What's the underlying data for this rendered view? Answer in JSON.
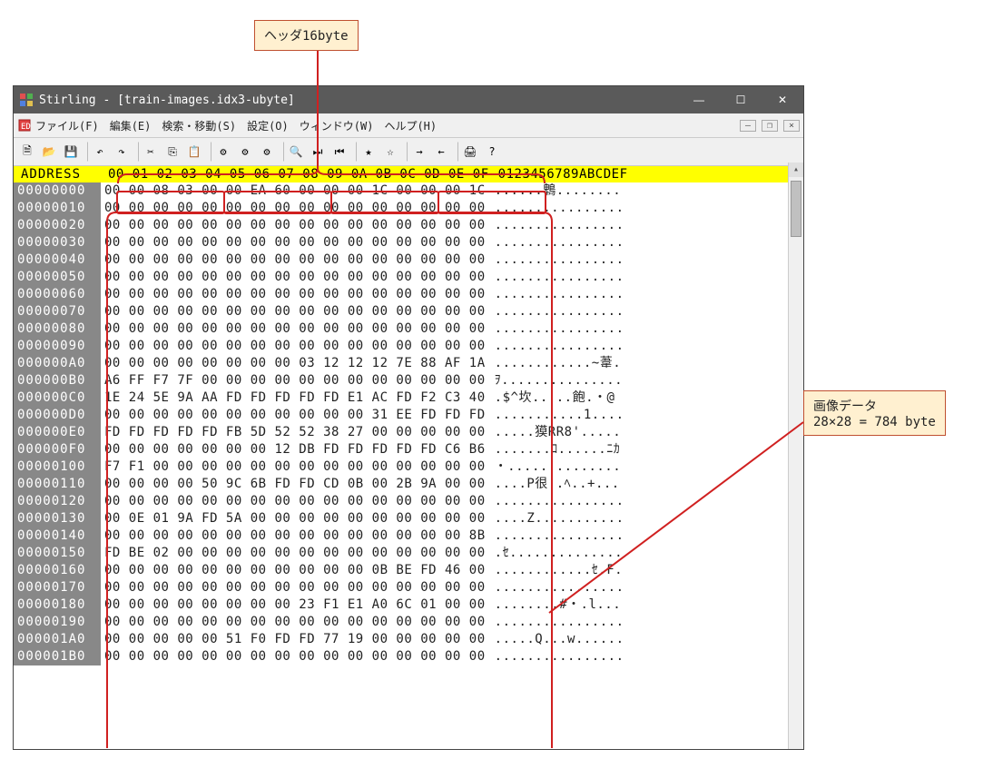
{
  "callouts": {
    "header_label": "ヘッダ16byte",
    "image_label_line1": "画像データ",
    "image_label_line2": "28×28 = 784 byte"
  },
  "app": {
    "title": "Stirling - [train-images.idx3-ubyte]"
  },
  "menu": {
    "file": "ファイル(F)",
    "edit": "編集(E)",
    "search": "検索・移動(S)",
    "settings": "設定(O)",
    "window": "ウィンドウ(W)",
    "help": "ヘルプ(H)"
  },
  "hex_header": {
    "address": "ADDRESS",
    "bytes": "00 01 02 03 04 05 06 07 08 09 0A 0B 0C 0D 0E 0F",
    "ascii": "0123456789ABCDEF"
  },
  "rows": [
    {
      "addr": "00000000",
      "hex": "00 00 08 03 00 00 EA 60 00 00 00 1C 00 00 00 1C",
      "asc": "......鵯........"
    },
    {
      "addr": "00000010",
      "hex": "00 00 00 00 00 00 00 00 00 00 00 00 00 00 00 00",
      "asc": "................"
    },
    {
      "addr": "00000020",
      "hex": "00 00 00 00 00 00 00 00 00 00 00 00 00 00 00 00",
      "asc": "................"
    },
    {
      "addr": "00000030",
      "hex": "00 00 00 00 00 00 00 00 00 00 00 00 00 00 00 00",
      "asc": "................"
    },
    {
      "addr": "00000040",
      "hex": "00 00 00 00 00 00 00 00 00 00 00 00 00 00 00 00",
      "asc": "................"
    },
    {
      "addr": "00000050",
      "hex": "00 00 00 00 00 00 00 00 00 00 00 00 00 00 00 00",
      "asc": "................"
    },
    {
      "addr": "00000060",
      "hex": "00 00 00 00 00 00 00 00 00 00 00 00 00 00 00 00",
      "asc": "................"
    },
    {
      "addr": "00000070",
      "hex": "00 00 00 00 00 00 00 00 00 00 00 00 00 00 00 00",
      "asc": "................"
    },
    {
      "addr": "00000080",
      "hex": "00 00 00 00 00 00 00 00 00 00 00 00 00 00 00 00",
      "asc": "................"
    },
    {
      "addr": "00000090",
      "hex": "00 00 00 00 00 00 00 00 00 00 00 00 00 00 00 00",
      "asc": "................"
    },
    {
      "addr": "000000A0",
      "hex": "00 00 00 00 00 00 00 00 03 12 12 12 7E 88 AF 1A",
      "asc": "............~葦."
    },
    {
      "addr": "000000B0",
      "hex": "A6 FF F7 7F 00 00 00 00 00 00 00 00 00 00 00 00",
      "asc": "ｦ..............."
    },
    {
      "addr": "000000C0",
      "hex": "1E 24 5E 9A AA FD FD FD FD FD E1 AC FD F2 C3 40",
      "asc": ".$^坎.....飽.・@"
    },
    {
      "addr": "000000D0",
      "hex": "00 00 00 00 00 00 00 00 00 00 00 31 EE FD FD FD",
      "asc": "...........1...."
    },
    {
      "addr": "000000E0",
      "hex": "FD FD FD FD FD FB 5D 52 52 38 27 00 00 00 00 00",
      "asc": ".....獏RR8'....."
    },
    {
      "addr": "000000F0",
      "hex": "00 00 00 00 00 00 00 12 DB FD FD FD FD FD C6 B6",
      "asc": ".......ﾛ......ﾆｶ"
    },
    {
      "addr": "00000100",
      "hex": "F7 F1 00 00 00 00 00 00 00 00 00 00 00 00 00 00",
      "asc": "・.............."
    },
    {
      "addr": "00000110",
      "hex": "00 00 00 00 50 9C 6B FD FD CD 0B 00 2B 9A 00 00",
      "asc": "....P很..ﾍ..+..."
    },
    {
      "addr": "00000120",
      "hex": "00 00 00 00 00 00 00 00 00 00 00 00 00 00 00 00",
      "asc": "................"
    },
    {
      "addr": "00000130",
      "hex": "00 0E 01 9A FD 5A 00 00 00 00 00 00 00 00 00 00",
      "asc": "....Z..........."
    },
    {
      "addr": "00000140",
      "hex": "00 00 00 00 00 00 00 00 00 00 00 00 00 00 00 8B",
      "asc": "................"
    },
    {
      "addr": "00000150",
      "hex": "FD BE 02 00 00 00 00 00 00 00 00 00 00 00 00 00",
      "asc": ".ｾ.............."
    },
    {
      "addr": "00000160",
      "hex": "00 00 00 00 00 00 00 00 00 00 00 0B BE FD 46 00",
      "asc": "............ｾ.F."
    },
    {
      "addr": "00000170",
      "hex": "00 00 00 00 00 00 00 00 00 00 00 00 00 00 00 00",
      "asc": "................"
    },
    {
      "addr": "00000180",
      "hex": "00 00 00 00 00 00 00 00 23 F1 E1 A0 6C 01 00 00",
      "asc": "........#・.l..."
    },
    {
      "addr": "00000190",
      "hex": "00 00 00 00 00 00 00 00 00 00 00 00 00 00 00 00",
      "asc": "................"
    },
    {
      "addr": "000001A0",
      "hex": "00 00 00 00 00 51 F0 FD FD 77 19 00 00 00 00 00",
      "asc": ".....Q...w......"
    },
    {
      "addr": "000001B0",
      "hex": "00 00 00 00 00 00 00 00 00 00 00 00 00 00 00 00",
      "asc": "................"
    }
  ]
}
